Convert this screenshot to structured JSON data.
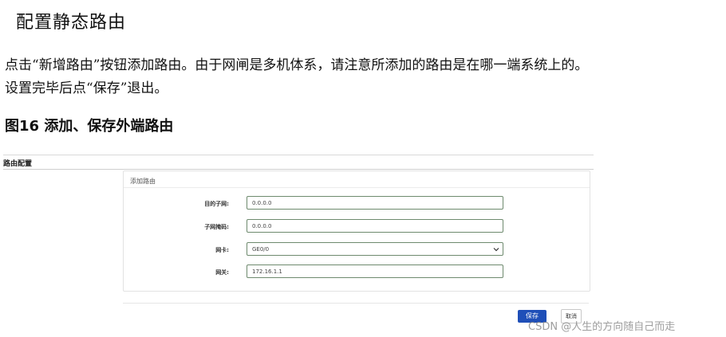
{
  "doc": {
    "heading": "配置静态路由",
    "paragraph_line1": "点击“新增路由”按钮添加路由。由于网闸是多机体系，请注意所添加的路由是在哪一端系统上的。",
    "paragraph_line2": "设置完毕后点“保存”退出。",
    "figure_caption": "图16  添加、保存外端路由"
  },
  "screenshot": {
    "section_title": "路由配置",
    "panel_title": "添加路由",
    "fields": [
      {
        "label": "目的子网:",
        "value": "0.0.0.0"
      },
      {
        "label": "子网掩码:",
        "value": "0.0.0.0"
      },
      {
        "label": "网卡:",
        "value": "GE0/0"
      },
      {
        "label": "网关:",
        "value": "172.16.1.1"
      }
    ],
    "save_label": "保存",
    "cancel_label": "取消"
  },
  "watermark": "CSDN @人生的方向随自己而走",
  "colors": {
    "save_button": "#1f4fb8",
    "input_border": "#6e8a6e"
  }
}
